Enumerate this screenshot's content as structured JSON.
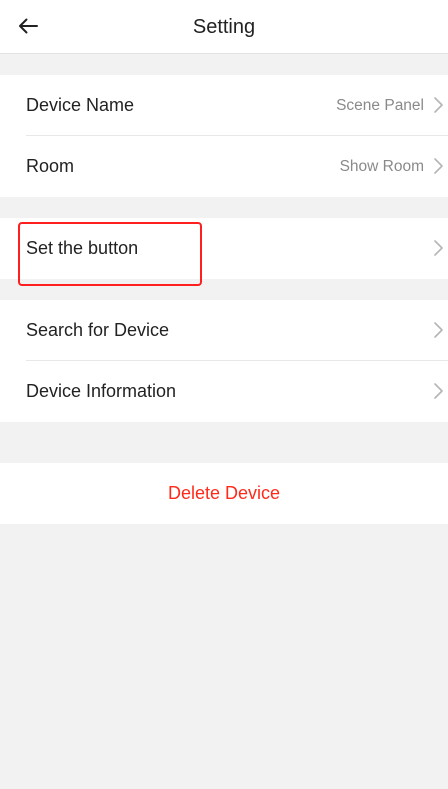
{
  "header": {
    "title": "Setting",
    "back_icon": "arrow-left-icon"
  },
  "groups": [
    {
      "items": [
        {
          "label": "Device Name",
          "value": "Scene Panel"
        },
        {
          "label": "Room",
          "value": "Show Room"
        }
      ]
    },
    {
      "items": [
        {
          "label": "Set the button",
          "value": "",
          "highlighted": true
        }
      ]
    },
    {
      "items": [
        {
          "label": "Search for Device",
          "value": ""
        },
        {
          "label": "Device Information",
          "value": ""
        }
      ]
    }
  ],
  "delete": {
    "label": "Delete Device"
  },
  "colors": {
    "background": "#f2f2f2",
    "card": "#ffffff",
    "text": "#222222",
    "secondary_text": "#8a8a8a",
    "danger": "#ff2a1a",
    "highlight_box": "#ff1f1f"
  }
}
